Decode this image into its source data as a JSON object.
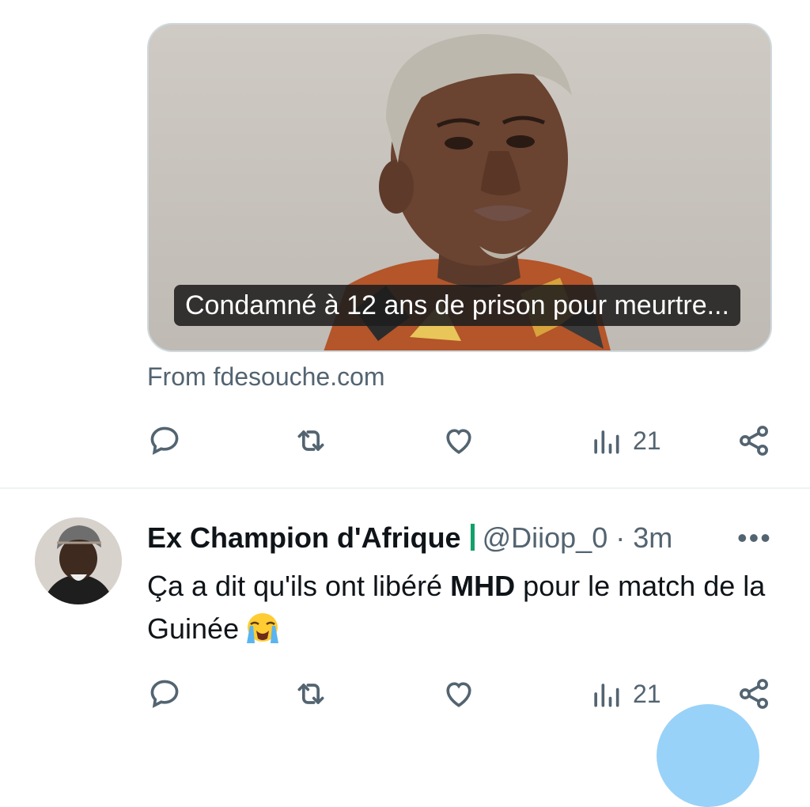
{
  "link_card": {
    "caption": "Condamné à 12 ans de prison pour meurtre...",
    "source": "From fdesouche.com"
  },
  "top_actions": {
    "reply_icon": "reply-icon",
    "retweet_icon": "retweet-icon",
    "like_icon": "like-icon",
    "views_icon": "views-icon",
    "views_count": "21",
    "share_icon": "share-icon"
  },
  "tweet": {
    "author_name": "Ex Champion d'Afrique",
    "handle": "@Diiop_0",
    "separator": "·",
    "time": "3m",
    "more": "•••",
    "text_part1": "Ça a dit qu'ils ont libéré ",
    "text_bold": "MHD",
    "text_part2": " pour le match de la Guinée",
    "emoji_icon": "loudly-crying-face-icon",
    "actions": {
      "views_count": "21"
    }
  },
  "colors": {
    "text_primary": "#0f1419",
    "text_secondary": "#536471",
    "border": "#cfd9de",
    "divider": "#eff3f4",
    "fab": "#8ecdf7",
    "flag_bar": "#14a06b"
  }
}
